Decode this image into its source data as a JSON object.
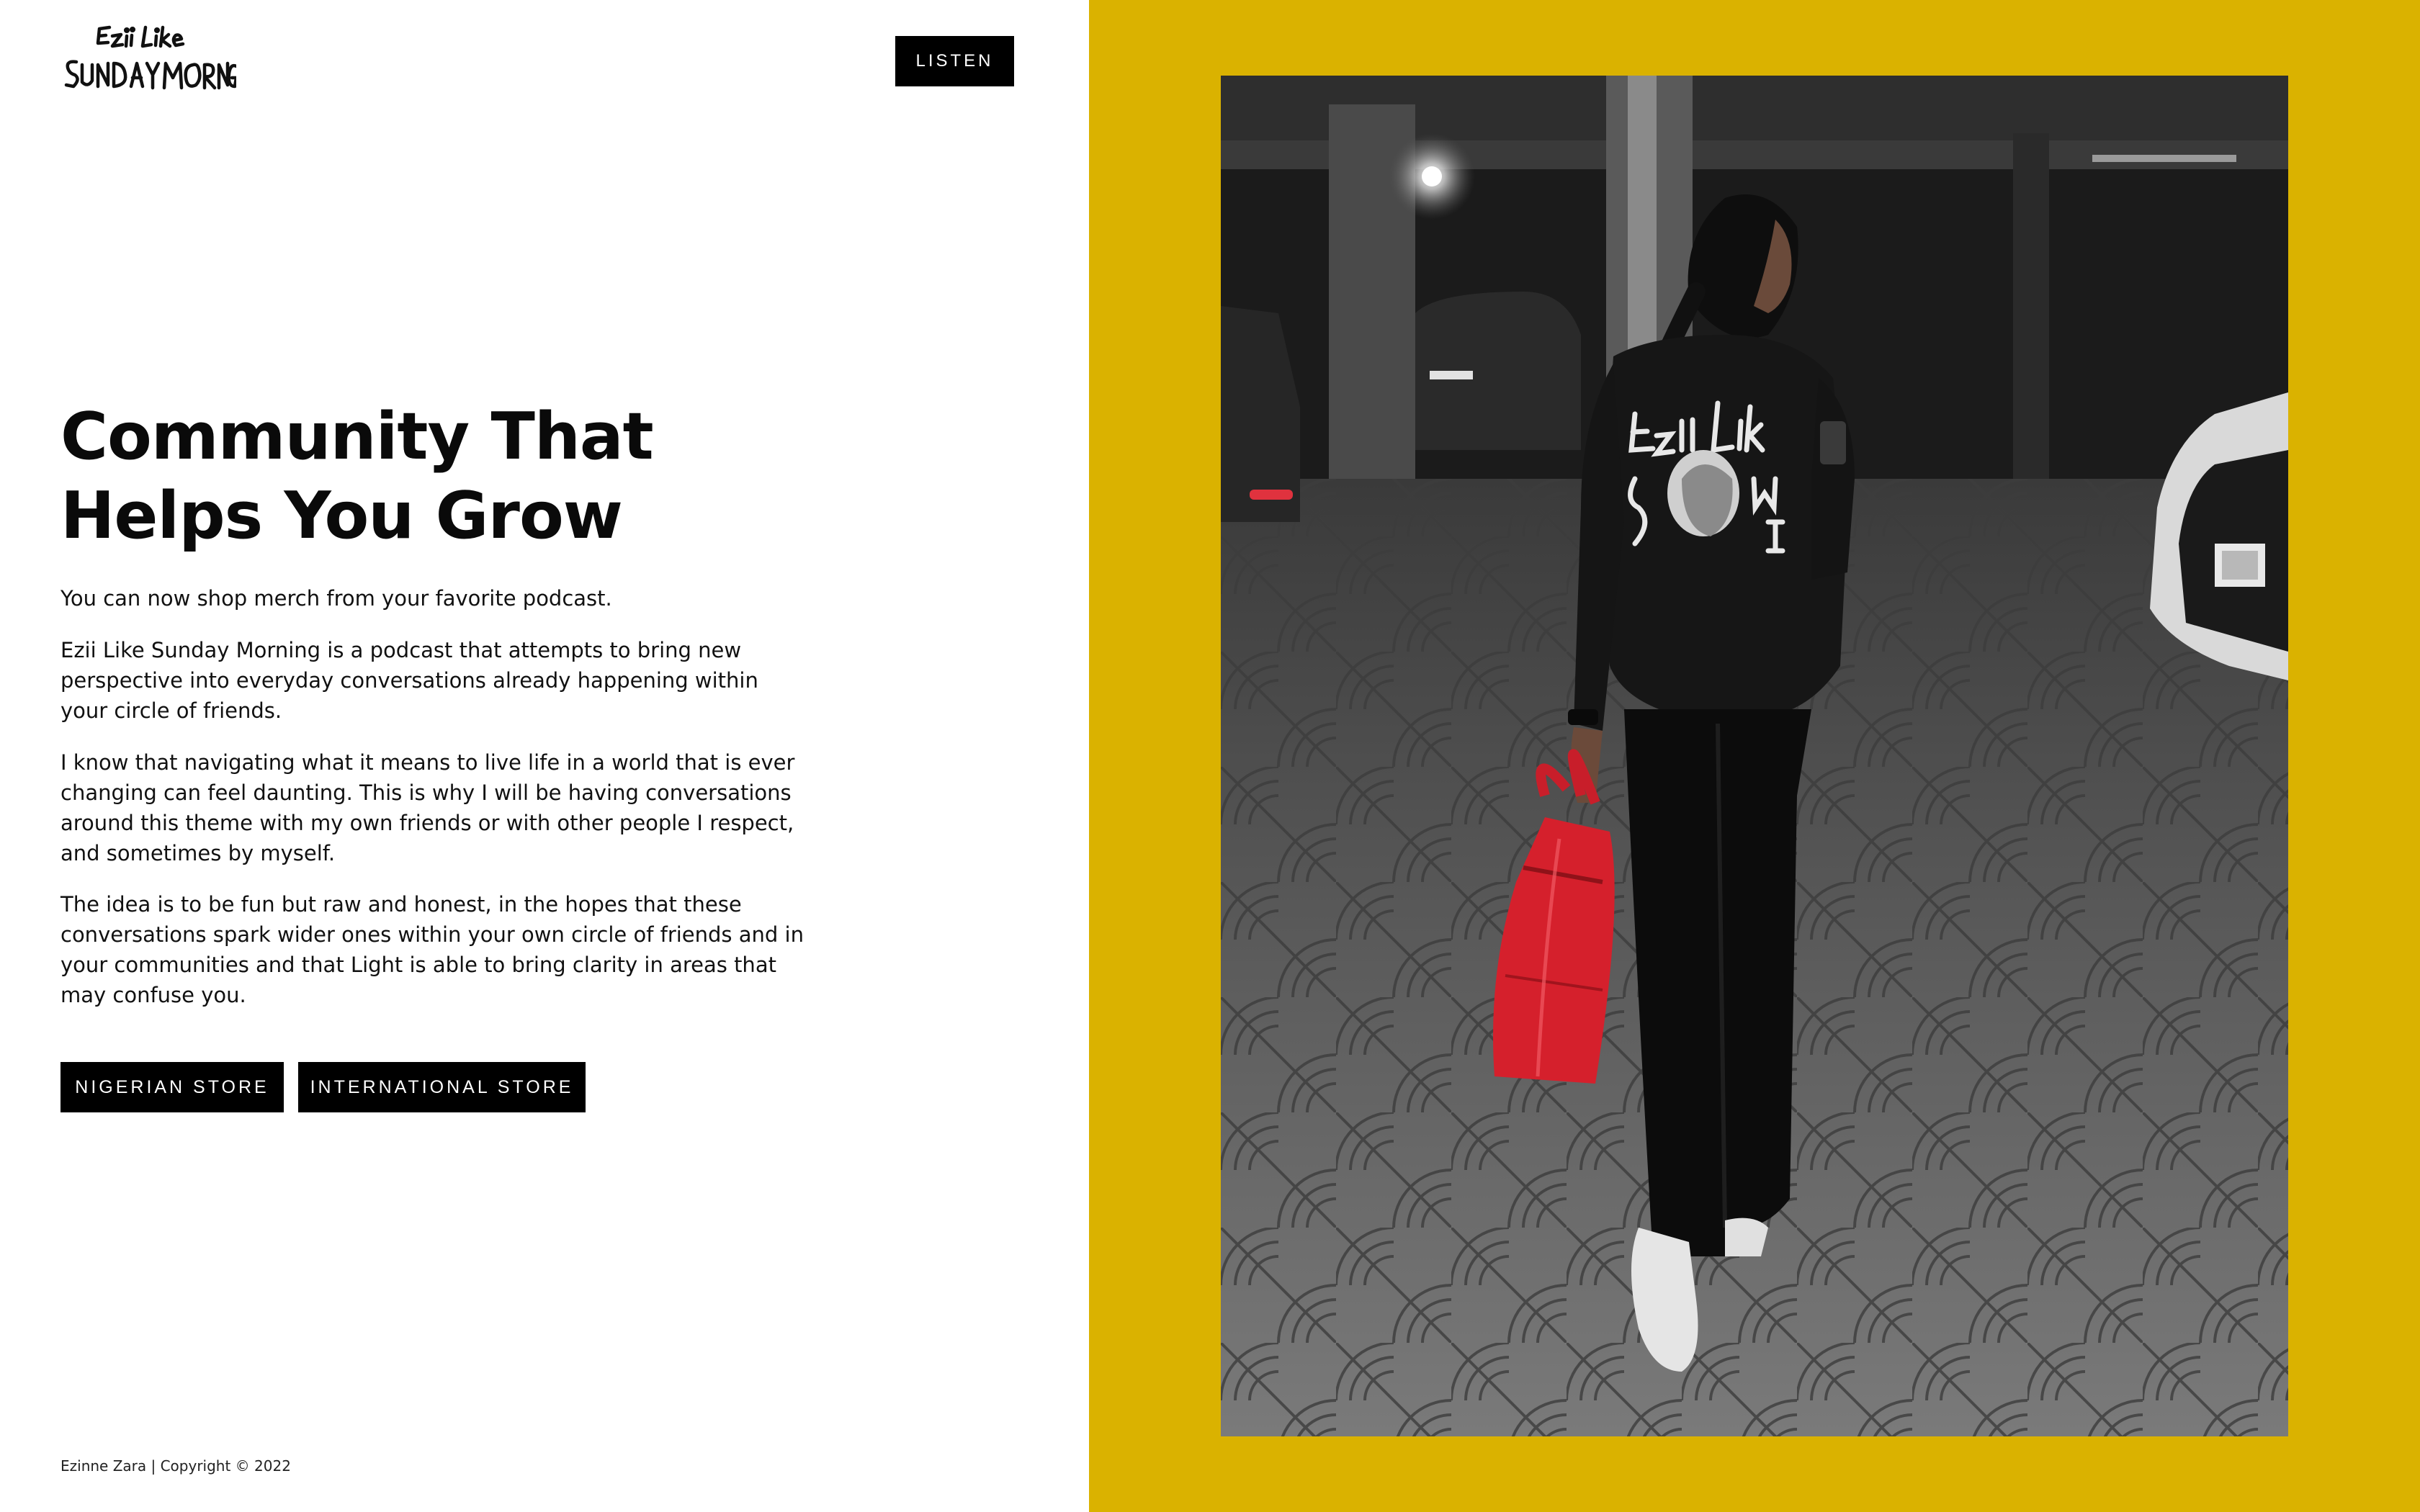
{
  "colors": {
    "accent_yellow": "#dab200",
    "button_black": "#000000",
    "button_text": "#ffffff",
    "bag_red": "#d5202c"
  },
  "header": {
    "logo_text": "Ezii Like Sunday Morning",
    "listen_label": "LISTEN"
  },
  "hero": {
    "headline_lines": [
      "Community That",
      "Helps You Grow"
    ],
    "paragraphs": [
      [
        "You can now shop merch from your favorite podcast."
      ],
      [
        "Ezii Like Sunday Morning is a podcast that attempts to bring new",
        "perspective into everyday conversations already happening within",
        "your circle of friends."
      ],
      [
        "I know that navigating what it means to live life in a world that is ever",
        "changing can feel daunting. This is why I will be having conversations",
        "around this theme with my own friends or with other people I respect,",
        "and sometimes by myself."
      ],
      [
        "The idea is to be fun but raw and honest, in the hopes that these",
        "conversations spark wider ones within your own circle of friends and in",
        "your communities and that Light is able to bring clarity in areas that",
        "may confuse you."
      ]
    ],
    "buttons": {
      "nigerian_store": "NIGERIAN STORE",
      "international_store": "INTERNATIONAL STORE"
    }
  },
  "footer": {
    "copyright": "Ezinne Zara | Copyright © 2022"
  },
  "photo": {
    "shirt_print_lines": [
      "Ezii Like",
      "Sunday",
      "Morning"
    ]
  }
}
